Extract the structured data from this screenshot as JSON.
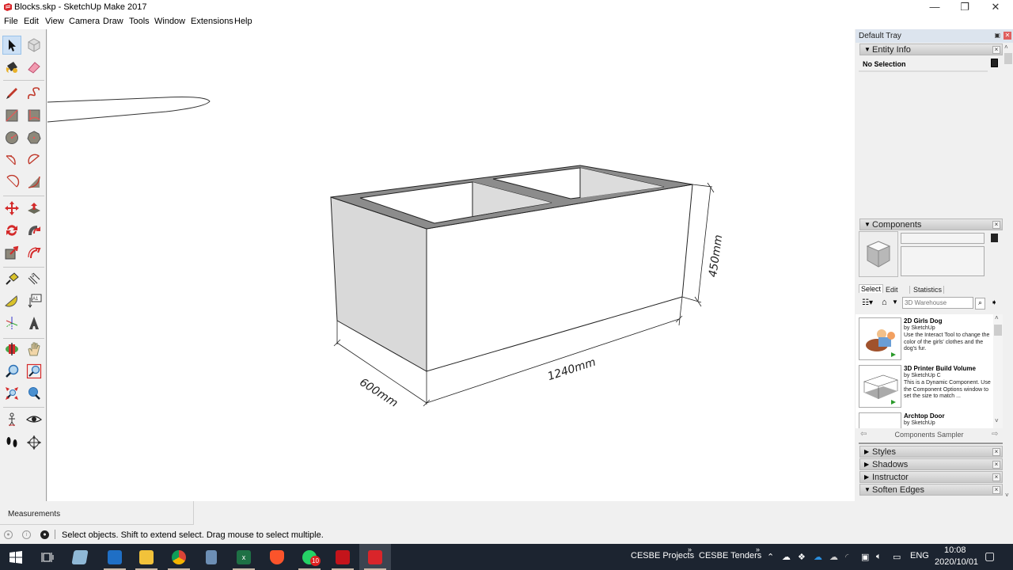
{
  "window": {
    "title": "Blocks.skp - SketchUp Make 2017",
    "minimize": "—",
    "maximize": "❐",
    "close": "✕"
  },
  "menu": [
    "File",
    "Edit",
    "View",
    "Camera",
    "Draw",
    "Tools",
    "Window",
    "Extensions",
    "Help"
  ],
  "toolbar": {
    "tools": [
      {
        "name": "select-tool",
        "icon": "arrow-cursor-icon",
        "active": true
      },
      {
        "name": "make-component-tool",
        "icon": "component-cube-icon"
      },
      {
        "name": "paint-bucket-tool",
        "icon": "paint-bucket-icon"
      },
      {
        "name": "eraser-tool",
        "icon": "eraser-icon"
      },
      {
        "name": "line-tool",
        "icon": "pencil-icon"
      },
      {
        "name": "freehand-tool",
        "icon": "freehand-icon"
      },
      {
        "name": "rectangle-tool",
        "icon": "rectangle-icon"
      },
      {
        "name": "rotated-rectangle-tool",
        "icon": "rotated-rectangle-icon"
      },
      {
        "name": "circle-tool",
        "icon": "circle-icon"
      },
      {
        "name": "polygon-tool",
        "icon": "polygon-icon"
      },
      {
        "name": "arc-tool",
        "icon": "arc-icon"
      },
      {
        "name": "pie-tool",
        "icon": "pie-icon"
      },
      {
        "name": "2pt-arc-tool",
        "icon": "two-point-arc-icon"
      },
      {
        "name": "3pt-arc-tool",
        "icon": "three-point-arc-icon"
      },
      {
        "name": "move-tool",
        "icon": "move-arrows-icon"
      },
      {
        "name": "push-pull-tool",
        "icon": "push-pull-icon"
      },
      {
        "name": "rotate-tool",
        "icon": "rotate-icon"
      },
      {
        "name": "follow-me-tool",
        "icon": "follow-me-icon"
      },
      {
        "name": "scale-tool",
        "icon": "scale-icon"
      },
      {
        "name": "offset-tool",
        "icon": "offset-icon"
      },
      {
        "name": "tape-measure-tool",
        "icon": "tape-measure-icon"
      },
      {
        "name": "dimension-tool",
        "icon": "dimension-icon"
      },
      {
        "name": "protractor-tool",
        "icon": "protractor-icon"
      },
      {
        "name": "text-tool",
        "icon": "text-label-icon"
      },
      {
        "name": "axes-tool",
        "icon": "axes-icon"
      },
      {
        "name": "3d-text-tool",
        "icon": "3d-text-icon"
      },
      {
        "name": "orbit-tool",
        "icon": "orbit-icon"
      },
      {
        "name": "pan-tool",
        "icon": "hand-icon"
      },
      {
        "name": "zoom-tool",
        "icon": "magnifier-icon"
      },
      {
        "name": "zoom-window-tool",
        "icon": "zoom-window-icon"
      },
      {
        "name": "zoom-extents-tool",
        "icon": "zoom-extents-icon"
      },
      {
        "name": "previous-view-tool",
        "icon": "previous-view-icon"
      },
      {
        "name": "position-camera-tool",
        "icon": "position-camera-icon"
      },
      {
        "name": "look-around-tool",
        "icon": "eye-icon"
      },
      {
        "name": "walk-tool",
        "icon": "footprints-icon"
      },
      {
        "name": "section-plane-tool",
        "icon": "section-plane-icon"
      }
    ]
  },
  "model": {
    "dimensions": {
      "width": "600mm",
      "length": "1240mm",
      "height": "450mm"
    }
  },
  "tray": {
    "title": "Default Tray",
    "pin": "▣",
    "entity_info": {
      "label": "Entity Info",
      "selection": "No Selection"
    },
    "components": {
      "label": "Components",
      "tabs": [
        "Select",
        "Edit",
        "Statistics"
      ],
      "active_tab": "Select",
      "search_placeholder": "3D Warehouse",
      "items": [
        {
          "name": "2D Girls Dog",
          "by": "by SketchUp",
          "desc": "Use the Interact Tool to change the color of the girls' clothes and the dog's fur."
        },
        {
          "name": "3D Printer Build Volume",
          "by": "by SketchUp C",
          "desc": "This is a Dynamic Component. Use the Component Options window to set the size to match ..."
        },
        {
          "name": "Archtop Door",
          "by": "by SketchUp",
          "desc": ""
        }
      ],
      "collection": "Components Sampler"
    },
    "collapsed_panels": [
      {
        "label": "Styles",
        "expanded": false
      },
      {
        "label": "Shadows",
        "expanded": false
      },
      {
        "label": "Instructor",
        "expanded": false
      },
      {
        "label": "Soften Edges",
        "expanded": true
      }
    ]
  },
  "measurements": {
    "label": "Measurements",
    "value": ""
  },
  "status": {
    "message": "Select objects. Shift to extend select. Drag mouse to select multiple."
  },
  "taskbar": {
    "apps": [
      {
        "name": "start",
        "color": "#ffffff"
      },
      {
        "name": "task-view",
        "color": "#cfd6df"
      },
      {
        "name": "notepad",
        "color": "#8fb8d6"
      },
      {
        "name": "outlook",
        "color": "#1f6fc5"
      },
      {
        "name": "file-explorer",
        "color": "#f2c23a"
      },
      {
        "name": "chrome",
        "color": "#db4437"
      },
      {
        "name": "calculator",
        "color": "#6d8fb5"
      },
      {
        "name": "excel",
        "color": "#1e7145"
      },
      {
        "name": "brave",
        "color": "#fb542b"
      },
      {
        "name": "whatsapp",
        "color": "#25d366",
        "badge": "10"
      },
      {
        "name": "acrobat",
        "color": "#c4141b"
      },
      {
        "name": "sketchup",
        "color": "#d9252a"
      }
    ],
    "toolbars": [
      "CESBE Projects",
      "CESBE Tenders"
    ],
    "language": "ENG",
    "time": "10:08",
    "date": "2020/10/01"
  },
  "colors": {
    "viewport_bg": "#ffffff",
    "face_shaded": "#d9d9d9",
    "top_face": "#8c8c8c",
    "active_tool_bg": "#cce0f5",
    "taskbar_bg": "#1c2430"
  }
}
